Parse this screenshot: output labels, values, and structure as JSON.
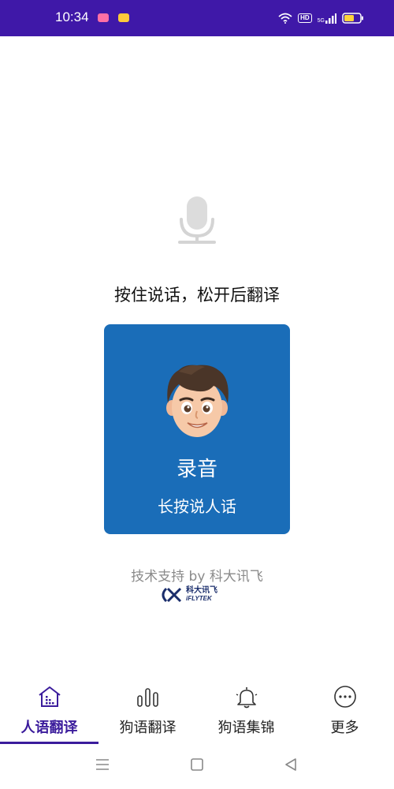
{
  "status_bar": {
    "time": "10:34",
    "hd": "HD",
    "network": "5G",
    "background": "#3f18a8"
  },
  "main": {
    "hint": "按住说话，松开后翻译",
    "record_button": {
      "title": "录音",
      "subtitle": "长按说人话",
      "background": "#1a6db8"
    },
    "tech_support": "技术支持 by 科大讯飞",
    "brand": {
      "cn": "科大讯飞",
      "en": "iFLYTEK"
    }
  },
  "bottom_nav": {
    "accent": "#3b1c9c",
    "items": [
      {
        "label": "人语翻译",
        "icon": "home-icon",
        "active": true
      },
      {
        "label": "狗语翻译",
        "icon": "bars-icon",
        "active": false
      },
      {
        "label": "狗语集锦",
        "icon": "bell-icon",
        "active": false
      },
      {
        "label": "更多",
        "icon": "more-icon",
        "active": false
      }
    ]
  },
  "system_nav": {
    "buttons": [
      "menu-icon",
      "home-square-icon",
      "back-icon"
    ]
  }
}
